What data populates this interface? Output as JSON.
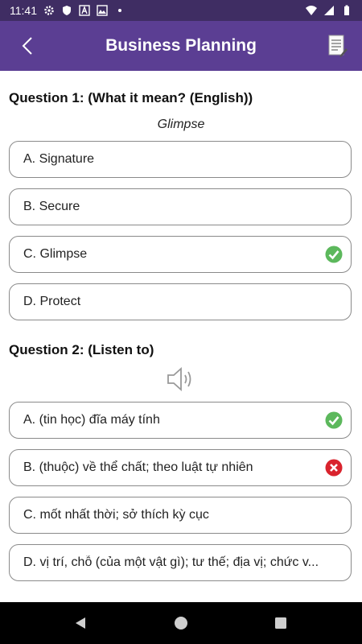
{
  "status_bar": {
    "time": "11:41",
    "icons_left": [
      "gear-icon",
      "shield-icon",
      "font-icon",
      "image-icon",
      "dot-icon"
    ],
    "icons_right": [
      "wifi-icon",
      "signal-icon",
      "battery-icon"
    ]
  },
  "app_bar": {
    "title": "Business Planning",
    "back_icon": "chevron-left-icon",
    "action_icon": "document-icon"
  },
  "questions": [
    {
      "title": "Question 1: (What it mean? (English))",
      "word": "Glimpse",
      "options": [
        {
          "label": "A. Signature",
          "mark": null
        },
        {
          "label": "B. Secure",
          "mark": null
        },
        {
          "label": "C. Glimpse",
          "mark": "correct"
        },
        {
          "label": "D. Protect",
          "mark": null
        }
      ]
    },
    {
      "title": "Question 2: (Listen to)",
      "audio_icon": "speaker-icon",
      "options": [
        {
          "label": "A. (tin học) đĩa máy tính",
          "mark": "correct"
        },
        {
          "label": "B. (thuộc) về thể chất; theo luật tự nhiên",
          "mark": "wrong"
        },
        {
          "label": "C. mốt nhất thời; sở thích kỳ cục",
          "mark": null
        },
        {
          "label": "D. vị trí, chỗ (của một vật gì); tư thế; địa vị; chức v...",
          "mark": null
        }
      ]
    }
  ],
  "nav_bar": {
    "buttons": [
      "back-triangle-icon",
      "home-circle-icon",
      "recents-square-icon"
    ]
  },
  "colors": {
    "status_bar": "#3f2d63",
    "app_bar": "#5b3e93",
    "correct": "#5cb85c",
    "wrong": "#d9232d"
  }
}
